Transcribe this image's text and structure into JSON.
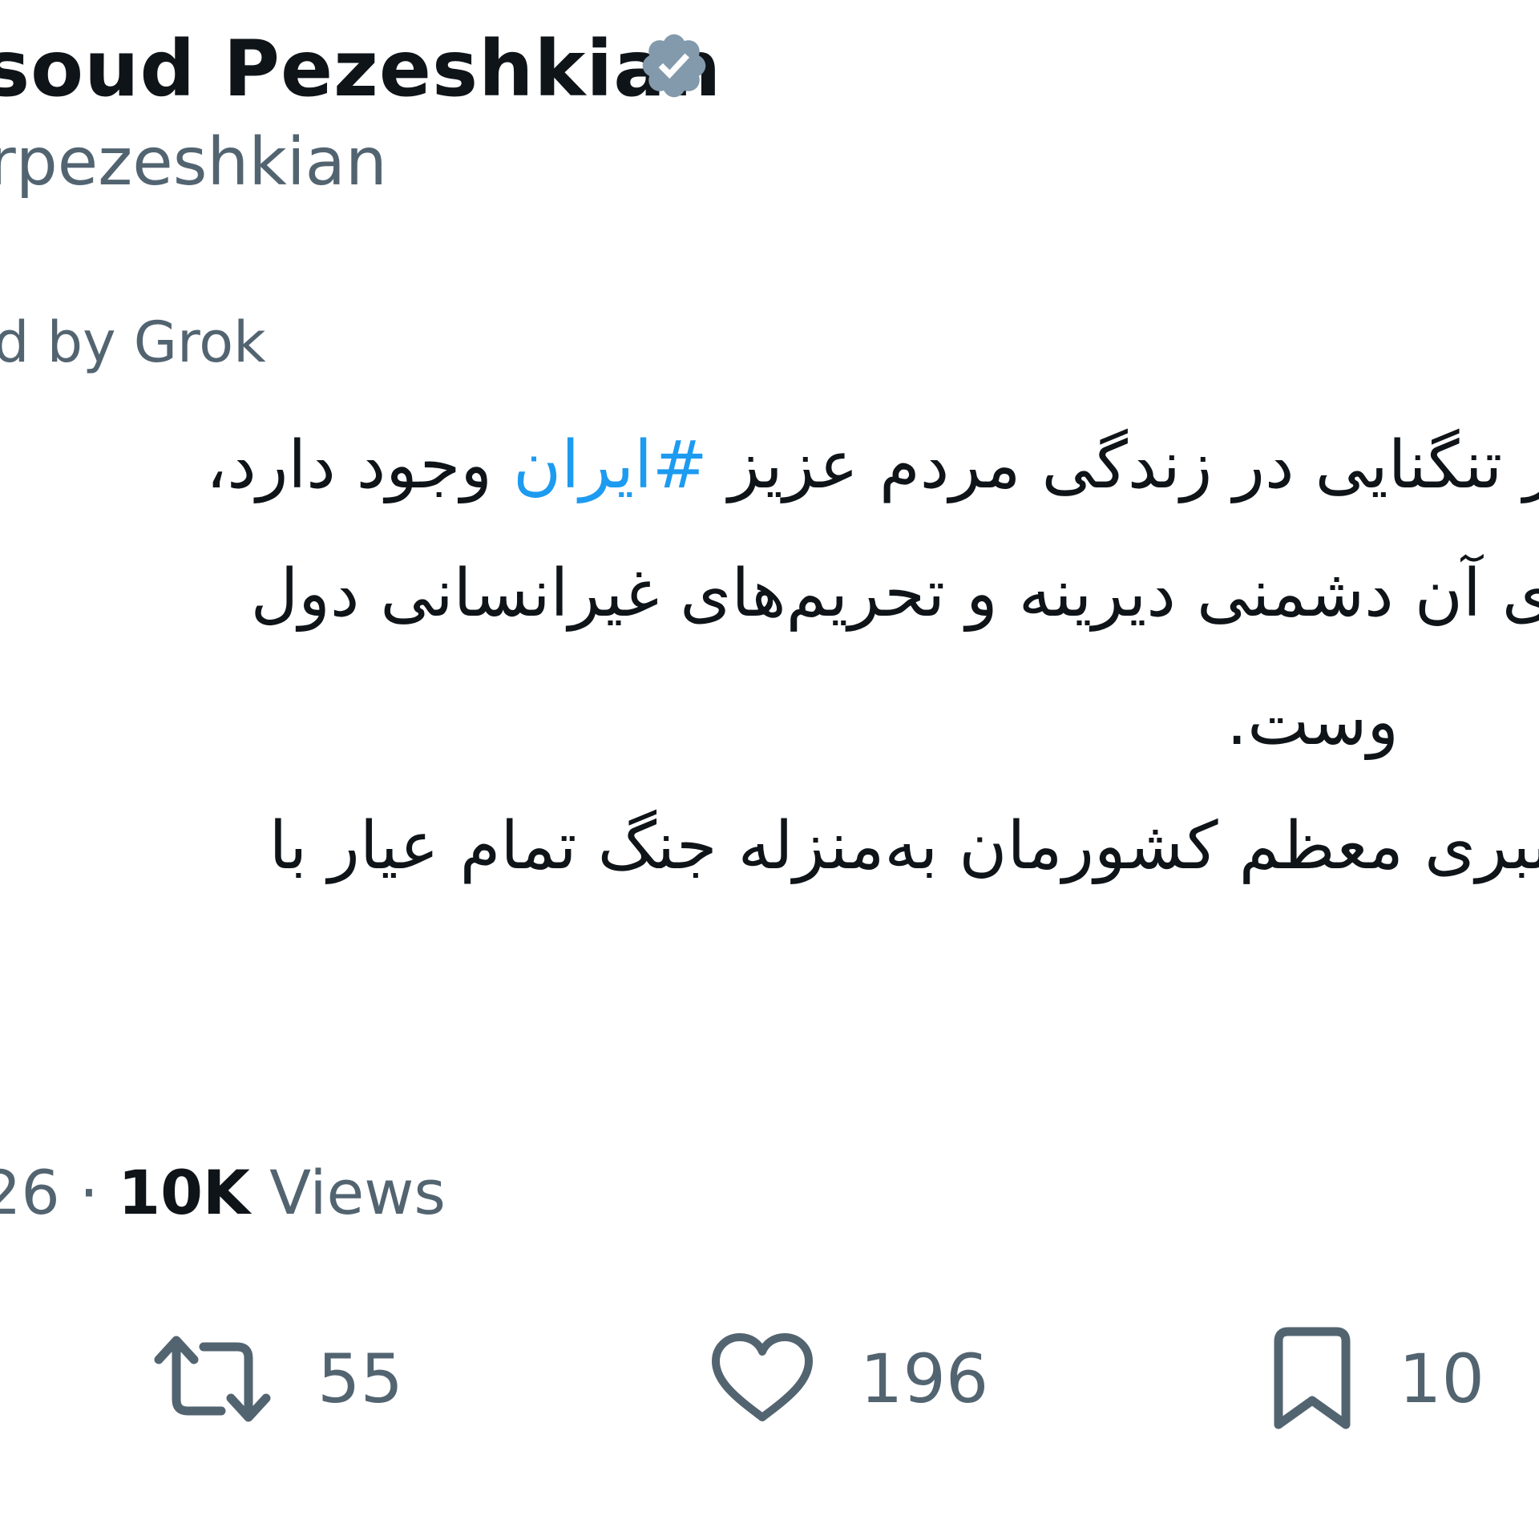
{
  "author": {
    "display_name": "soud Pezeshkian",
    "handle": "rpezeshkian",
    "verified_icon": "verified-badge-icon"
  },
  "translation_note": "d by Grok",
  "tweet": {
    "line1_prefix": "ر تنگنایی در زندگی مردم عزیز ",
    "hashtag": "#ایران",
    "line1_suffix": " وجود دارد،",
    "line2": "ی آن دشمنی دیرینه و تحریم‌های غیرانسانی دول",
    "line3": "وست.",
    "line4": "ببری معظم کشورمان به‌منزله جنگ تمام عیار با"
  },
  "meta": {
    "time_fragment": "26",
    "separator": "·",
    "views_count": "10K",
    "views_label": "Views"
  },
  "actions": {
    "retweets": "55",
    "likes": "196",
    "bookmarks": "10"
  },
  "colors": {
    "text": "#0f1419",
    "secondary": "#536471",
    "link": "#1d9bf0",
    "verified_badge": "#829aab"
  }
}
